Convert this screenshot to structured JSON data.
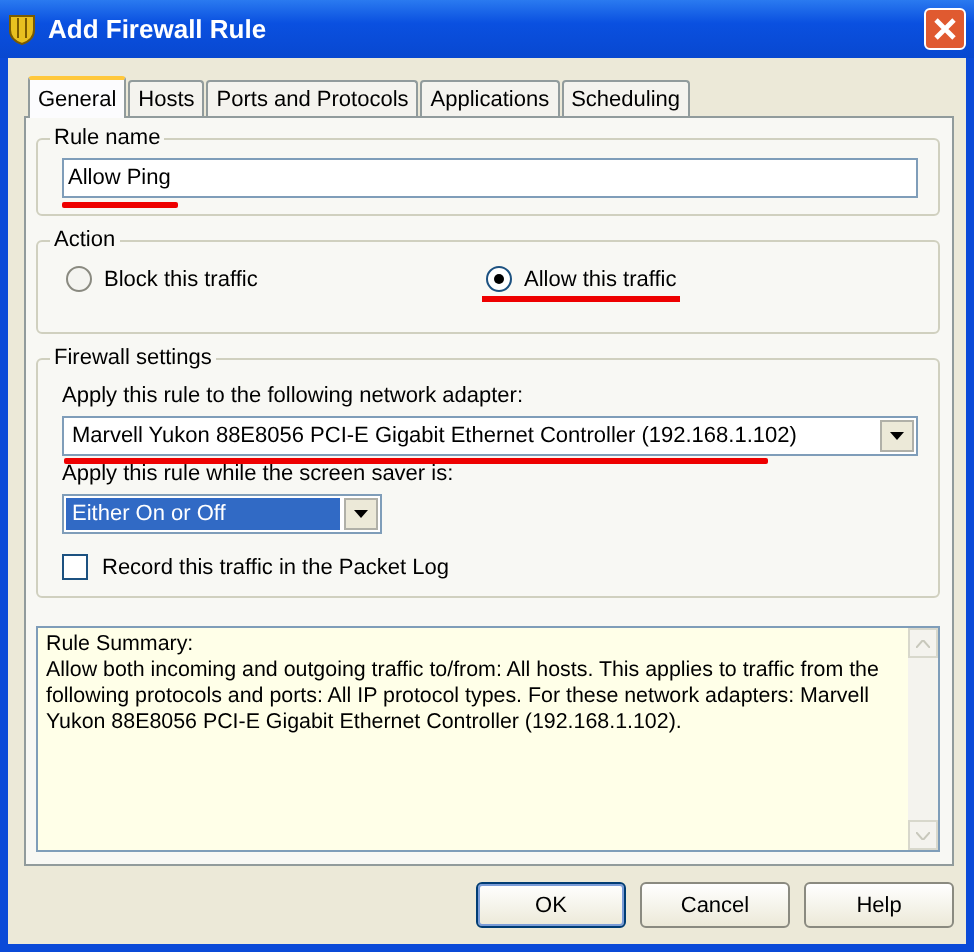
{
  "window": {
    "title": "Add Firewall Rule"
  },
  "tabs": [
    {
      "label": "General",
      "selected": true
    },
    {
      "label": "Hosts",
      "selected": false
    },
    {
      "label": "Ports and Protocols",
      "selected": false
    },
    {
      "label": "Applications",
      "selected": false
    },
    {
      "label": "Scheduling",
      "selected": false
    }
  ],
  "rule_name": {
    "legend": "Rule name",
    "value": "Allow Ping",
    "underlined": true
  },
  "action": {
    "legend": "Action",
    "options": [
      {
        "label": "Block this traffic",
        "selected": false,
        "underlined": false
      },
      {
        "label": "Allow this traffic",
        "selected": true,
        "underlined": true
      }
    ]
  },
  "firewall_settings": {
    "legend": "Firewall settings",
    "adapter_label": "Apply this rule to the following network adapter:",
    "adapter": {
      "value": "Marvell Yukon 88E8056 PCI-E Gigabit Ethernet Controller (192.168.1.102)",
      "focused": false,
      "underlined": true
    },
    "screensaver_label": "Apply this rule while the screen saver is:",
    "screensaver": {
      "value": "Either On or Off",
      "focused": true
    },
    "log": {
      "label": "Record this traffic in the Packet Log",
      "checked": false
    }
  },
  "summary": {
    "heading": "Rule Summary:",
    "text": "Allow both incoming and outgoing traffic to/from: All hosts. This applies to traffic from the following protocols and ports: All IP protocol types. For these network adapters: Marvell Yukon 88E8056 PCI-E Gigabit Ethernet Controller (192.168.1.102)."
  },
  "buttons": [
    {
      "label": "OK",
      "default": true
    },
    {
      "label": "Cancel",
      "default": false
    },
    {
      "label": "Help",
      "default": false
    }
  ]
}
